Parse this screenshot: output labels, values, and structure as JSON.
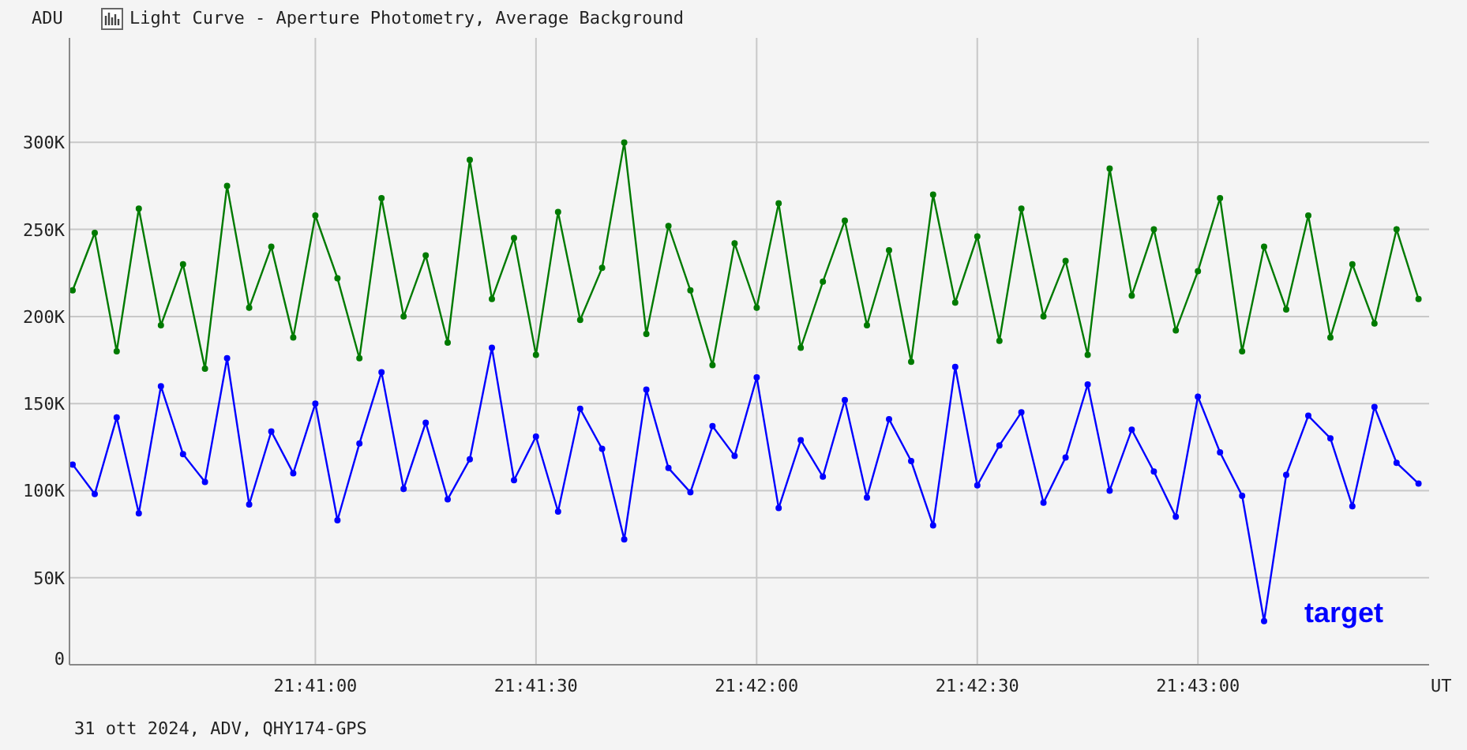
{
  "window": {
    "title": "Light Curve - Aperture Photometry, Average Background"
  },
  "chart": {
    "chart_data": {
      "type": "line",
      "grid": true,
      "ylabel": "ADU",
      "xlabel": "UT",
      "xlim": [
        78027,
        78211
      ],
      "ylim": [
        0,
        360000
      ],
      "yticks": [
        {
          "value": 300000,
          "label": "300K"
        },
        {
          "value": 250000,
          "label": "250K"
        },
        {
          "value": 200000,
          "label": "200K"
        },
        {
          "value": 150000,
          "label": "150K"
        },
        {
          "value": 100000,
          "label": "100K"
        },
        {
          "value": 50000,
          "label": "50K"
        },
        {
          "value": 0,
          "label": "0"
        }
      ],
      "xticks": [
        {
          "value": 78060,
          "label": "21:41:00"
        },
        {
          "value": 78090,
          "label": "21:41:30"
        },
        {
          "value": 78120,
          "label": "21:42:00"
        },
        {
          "value": 78150,
          "label": "21:42:30"
        },
        {
          "value": 78180,
          "label": "21:43:00"
        }
      ],
      "x": [
        78027,
        78030,
        78033,
        78036,
        78039,
        78042,
        78045,
        78048,
        78051,
        78054,
        78057,
        78060,
        78063,
        78066,
        78069,
        78072,
        78075,
        78078,
        78081,
        78084,
        78087,
        78090,
        78093,
        78096,
        78099,
        78102,
        78105,
        78108,
        78111,
        78114,
        78117,
        78120,
        78123,
        78126,
        78129,
        78132,
        78135,
        78138,
        78141,
        78144,
        78147,
        78150,
        78153,
        78156,
        78159,
        78162,
        78165,
        78168,
        78171,
        78174,
        78177,
        78180,
        78183,
        78186,
        78189,
        78192,
        78195,
        78198,
        78201,
        78204,
        78207,
        78210
      ],
      "series": [
        {
          "name": "target",
          "color": "#0000ff",
          "marker": "circle",
          "values": [
            115000,
            98000,
            142000,
            87000,
            160000,
            121000,
            105000,
            176000,
            92000,
            134000,
            110000,
            150000,
            83000,
            127000,
            168000,
            101000,
            139000,
            95000,
            118000,
            182000,
            106000,
            131000,
            88000,
            147000,
            124000,
            72000,
            158000,
            113000,
            99000,
            137000,
            120000,
            165000,
            90000,
            129000,
            108000,
            152000,
            96000,
            141000,
            117000,
            80000,
            171000,
            103000,
            126000,
            145000,
            93000,
            119000,
            161000,
            100000,
            135000,
            111000,
            85000,
            154000,
            122000,
            97000,
            25000,
            109000,
            143000,
            130000,
            91000,
            148000,
            116000,
            104000
          ]
        },
        {
          "color": "#007a00",
          "marker": "circle",
          "values": [
            215000,
            248000,
            180000,
            262000,
            195000,
            230000,
            170000,
            275000,
            205000,
            240000,
            188000,
            258000,
            222000,
            176000,
            268000,
            200000,
            235000,
            185000,
            290000,
            210000,
            245000,
            178000,
            260000,
            198000,
            228000,
            300000,
            190000,
            252000,
            215000,
            172000,
            242000,
            205000,
            265000,
            182000,
            220000,
            255000,
            195000,
            238000,
            174000,
            270000,
            208000,
            246000,
            186000,
            262000,
            200000,
            232000,
            178000,
            285000,
            212000,
            250000,
            192000,
            226000,
            268000,
            180000,
            240000,
            204000,
            258000,
            188000,
            230000,
            196000,
            250000,
            210000
          ]
        }
      ]
    }
  },
  "status_bar": "31 ott 2024, ADV, QHY174-GPS"
}
